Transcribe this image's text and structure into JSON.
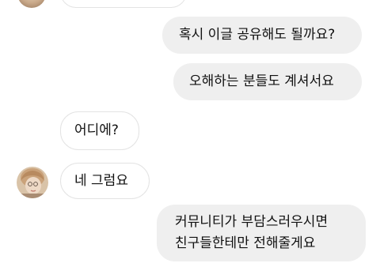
{
  "messages": [
    {
      "side": "sent",
      "text": "혹시 이글 공유해도 될까요?"
    },
    {
      "side": "sent",
      "text": "오해하는 분들도 계셔서요"
    },
    {
      "side": "received",
      "text": "어디에?"
    },
    {
      "side": "received",
      "text": "네 그럼요"
    },
    {
      "side": "sent",
      "lines": [
        "커뮤니티가 부담스러우시면",
        "친구들한테만 전해줄게요"
      ]
    }
  ],
  "colors": {
    "sent_bubble": "#efefef",
    "received_bubble": "#ffffff",
    "received_border": "#e3e3e3",
    "text": "#111111"
  }
}
